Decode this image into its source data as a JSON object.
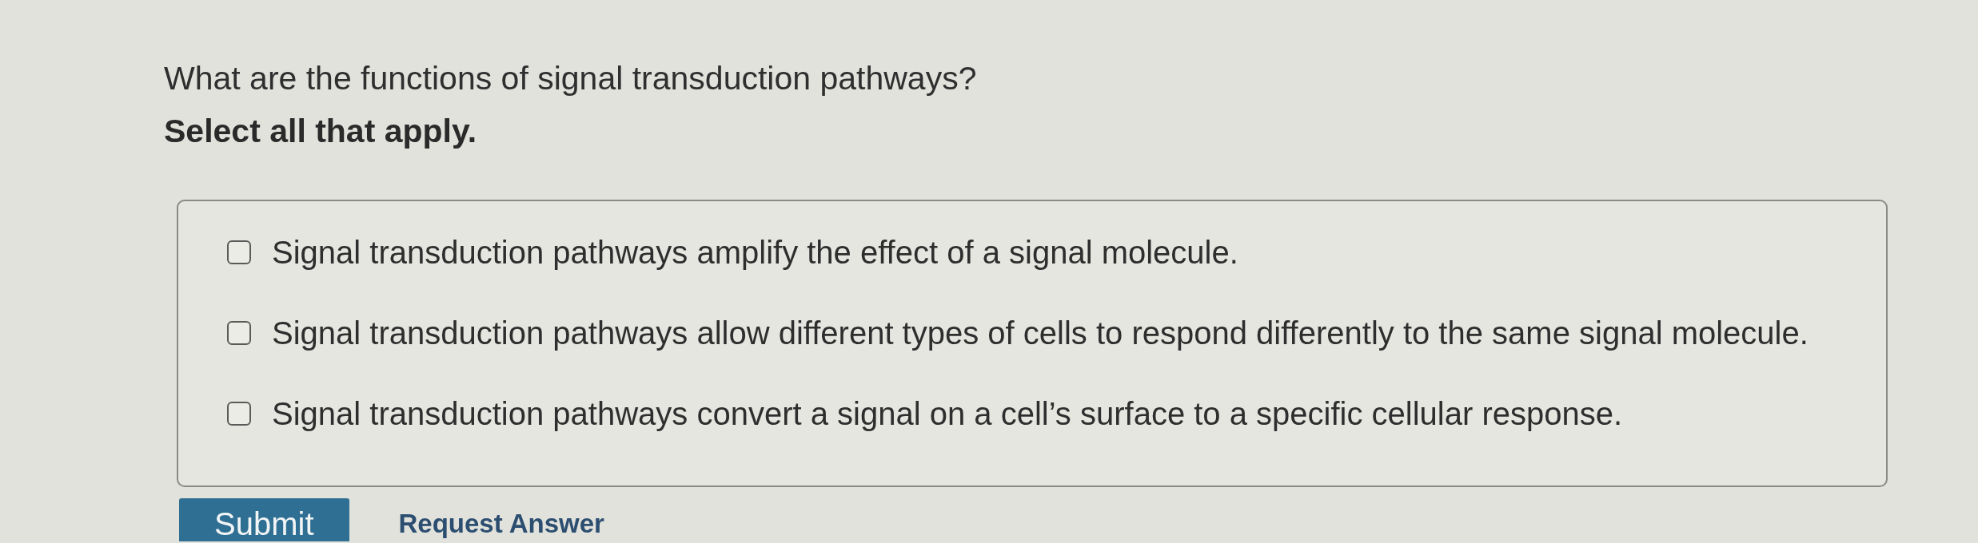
{
  "question": {
    "prompt": "What are the functions of signal transduction pathways?",
    "instruction": "Select all that apply."
  },
  "options": [
    {
      "label": "Signal transduction pathways amplify the effect of a signal molecule.",
      "checked": false
    },
    {
      "label": "Signal transduction pathways allow different types of cells to respond differently to the same signal molecule.",
      "checked": false
    },
    {
      "label": "Signal transduction pathways convert a signal on a cell’s surface to a specific cellular response.",
      "checked": false
    }
  ],
  "buttons": [
    {
      "kind": "primary",
      "label": "Submit"
    },
    {
      "kind": "link",
      "label": "Request Answer"
    }
  ]
}
